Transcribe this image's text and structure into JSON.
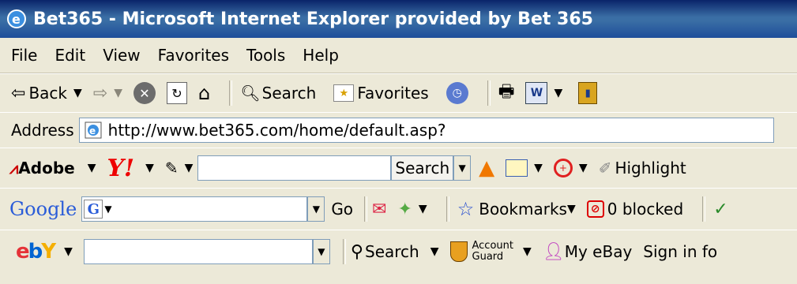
{
  "window": {
    "title": "Bet365 - Microsoft Internet Explorer provided by Bet 365"
  },
  "menu": [
    "File",
    "Edit",
    "View",
    "Favorites",
    "Tools",
    "Help"
  ],
  "nav": {
    "back": "Back",
    "search": "Search",
    "favorites": "Favorites"
  },
  "address": {
    "label": "Address",
    "url": "http://www.bet365.com/home/default.asp?"
  },
  "adobe": {
    "label": "Adobe",
    "search_button": "Search",
    "highlight": "Highlight",
    "search_value": ""
  },
  "google": {
    "brand": "Google",
    "go": "Go",
    "bookmarks": "Bookmarks",
    "blocked": "0 blocked",
    "search_value": ""
  },
  "ebay": {
    "search": "Search",
    "account_line1": "Account",
    "account_line2": "Guard",
    "my_ebay": "My eBay",
    "sign_in": "Sign in fo",
    "search_value": ""
  }
}
